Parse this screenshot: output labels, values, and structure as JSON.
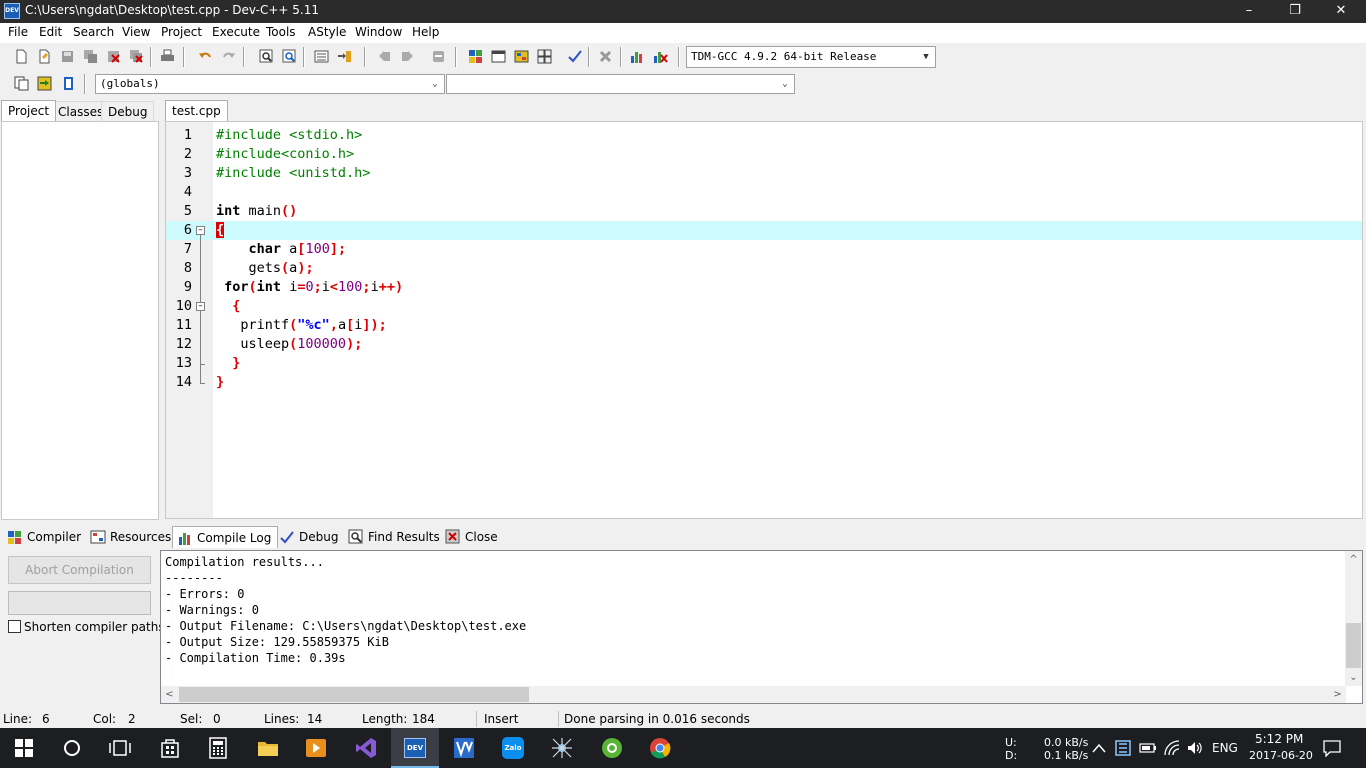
{
  "window": {
    "title": "C:\\Users\\ngdat\\Desktop\\test.cpp - Dev-C++ 5.11",
    "app_icon_text": "DEV"
  },
  "menu": [
    "File",
    "Edit",
    "Search",
    "View",
    "Project",
    "Execute",
    "Tools",
    "AStyle",
    "Window",
    "Help"
  ],
  "toolbar": {
    "compiler_select": "TDM-GCC 4.9.2 64-bit Release",
    "scope_select": "(globals)",
    "member_select": ""
  },
  "left_tabs": [
    "Project",
    "Classes",
    "Debug"
  ],
  "editor": {
    "file_tab": "test.cpp",
    "lines": [
      {
        "n": "1",
        "text": "#include <stdio.h>"
      },
      {
        "n": "2",
        "text": "#include<conio.h>"
      },
      {
        "n": "3",
        "text": "#include <unistd.h>"
      },
      {
        "n": "4",
        "text": ""
      },
      {
        "n": "5",
        "text": "int main()"
      },
      {
        "n": "6",
        "text": "{"
      },
      {
        "n": "7",
        "text": "    char a[100];"
      },
      {
        "n": "8",
        "text": "    gets(a);"
      },
      {
        "n": "9",
        "text": " for(int i=0;i<100;i++)"
      },
      {
        "n": "10",
        "text": "  {"
      },
      {
        "n": "11",
        "text": "   printf(\"%c\",a[i]);"
      },
      {
        "n": "12",
        "text": "   usleep(100000);"
      },
      {
        "n": "13",
        "text": "  }"
      },
      {
        "n": "14",
        "text": "}"
      }
    ]
  },
  "bottom_tabs": [
    "Compiler",
    "Resources",
    "Compile Log",
    "Debug",
    "Find Results",
    "Close"
  ],
  "compile": {
    "abort_label": "Abort Compilation",
    "shorten_label": "Shorten compiler paths",
    "log": [
      "Compilation results...",
      "--------",
      "- Errors: 0",
      "- Warnings: 0",
      "- Output Filename: C:\\Users\\ngdat\\Desktop\\test.exe",
      "- Output Size: 129.55859375 KiB",
      "- Compilation Time: 0.39s"
    ]
  },
  "status": {
    "line_label": "Line:",
    "line": "6",
    "col_label": "Col:",
    "col": "2",
    "sel_label": "Sel:",
    "sel": "0",
    "lines_label": "Lines:",
    "lines": "14",
    "length_label": "Length:",
    "length": "184",
    "mode": "Insert",
    "message": "Done parsing in 0.016 seconds"
  },
  "taskbar": {
    "net_u_label": "U:",
    "net_u": "0.0 kB/s",
    "net_d_label": "D:",
    "net_d": "0.1 kB/s",
    "lang": "ENG",
    "time": "5:12 PM",
    "date": "2017-06-20",
    "dev_icon_text": "DEV",
    "zalo_text": "Zalo"
  }
}
